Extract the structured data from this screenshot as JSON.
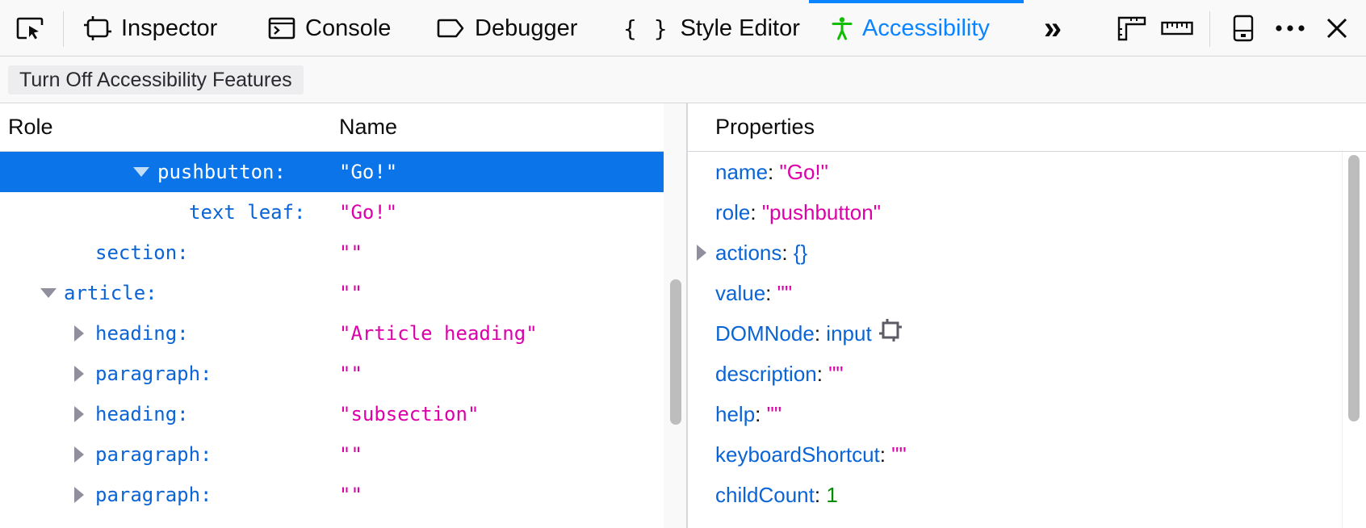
{
  "toolbar": {
    "tabs": [
      {
        "label": "Inspector",
        "icon": "inspector-icon"
      },
      {
        "label": "Console",
        "icon": "console-icon"
      },
      {
        "label": "Debugger",
        "icon": "debugger-icon"
      },
      {
        "label": "Style Editor",
        "icon": "style-editor-icon"
      },
      {
        "label": "Accessibility",
        "icon": "accessibility-icon",
        "active": true
      }
    ],
    "overflow_glyph": "»",
    "accent_color": "#0a84ff"
  },
  "accessibility": {
    "turn_off_label": "Turn Off Accessibility Features"
  },
  "tree": {
    "headers": {
      "role": "Role",
      "name": "Name"
    },
    "rows": [
      {
        "role": "pushbutton:",
        "name": "\"Go!\"",
        "expanded": true,
        "selected": true
      },
      {
        "role": "text leaf:",
        "name": "\"Go!\""
      },
      {
        "role": "section:",
        "name": "\"\""
      },
      {
        "role": "article:",
        "name": "\"\"",
        "expanded": true
      },
      {
        "role": "heading:",
        "name": "\"Article heading\"",
        "collapsed": true
      },
      {
        "role": "paragraph:",
        "name": "\"\"",
        "collapsed": true
      },
      {
        "role": "heading:",
        "name": "\"subsection\"",
        "collapsed": true
      },
      {
        "role": "paragraph:",
        "name": "\"\"",
        "collapsed": true
      },
      {
        "role": "paragraph:",
        "name": "\"\"",
        "collapsed": true
      }
    ]
  },
  "properties": {
    "header": "Properties",
    "items": [
      {
        "key": "name",
        "colon": ":",
        "value": "\"Go!\"",
        "type": "string"
      },
      {
        "key": "role",
        "colon": ":",
        "value": "\"pushbutton\"",
        "type": "string"
      },
      {
        "key": "actions",
        "colon": ":",
        "value": "{}",
        "type": "object",
        "expandable": true
      },
      {
        "key": "value",
        "colon": ":",
        "value": "\"\"",
        "type": "string"
      },
      {
        "key": "DOMNode",
        "colon": ":",
        "value": "input",
        "type": "node"
      },
      {
        "key": "description",
        "colon": ":",
        "value": "\"\"",
        "type": "string"
      },
      {
        "key": "help",
        "colon": ":",
        "value": "\"\"",
        "type": "string"
      },
      {
        "key": "keyboardShortcut",
        "colon": ":",
        "value": "\"\"",
        "type": "string"
      },
      {
        "key": "childCount",
        "colon": ":",
        "value": "1",
        "type": "number"
      }
    ]
  }
}
